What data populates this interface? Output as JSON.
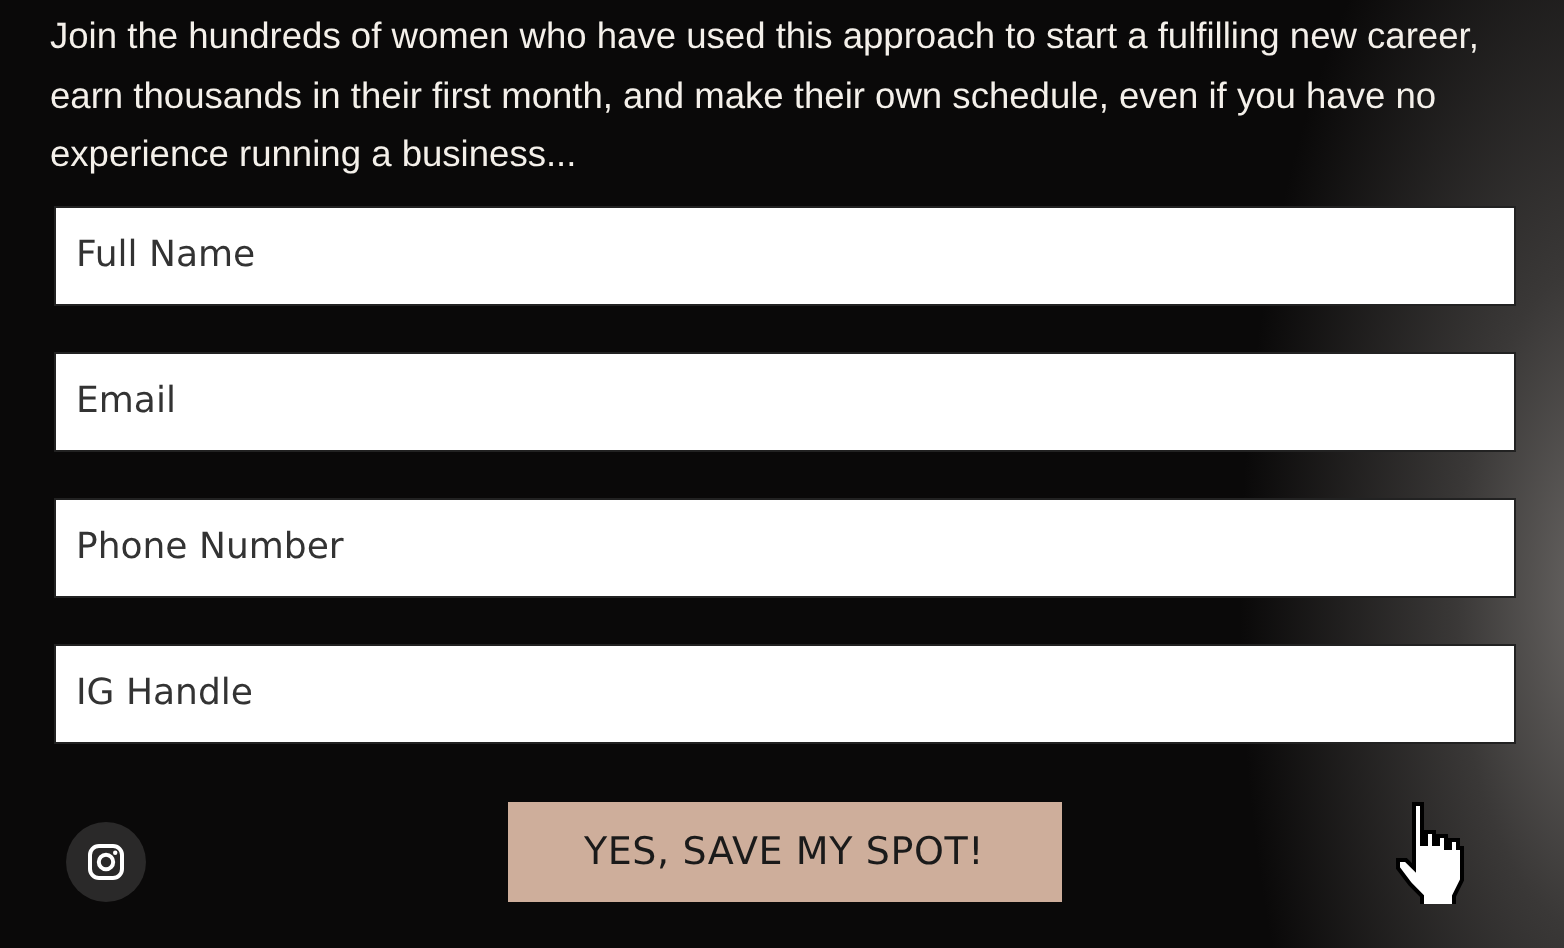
{
  "intro": "Join the hundreds of women who have used this approach to start a fulfilling new career, earn thousands in their first month, and make their own schedule, even if you have no experience running a business...",
  "fields": [
    {
      "placeholder": "Full Name"
    },
    {
      "placeholder": "Email"
    },
    {
      "placeholder": "Phone Number"
    },
    {
      "placeholder": "IG Handle"
    }
  ],
  "submit_button": "YES, SAVE MY SPOT!"
}
